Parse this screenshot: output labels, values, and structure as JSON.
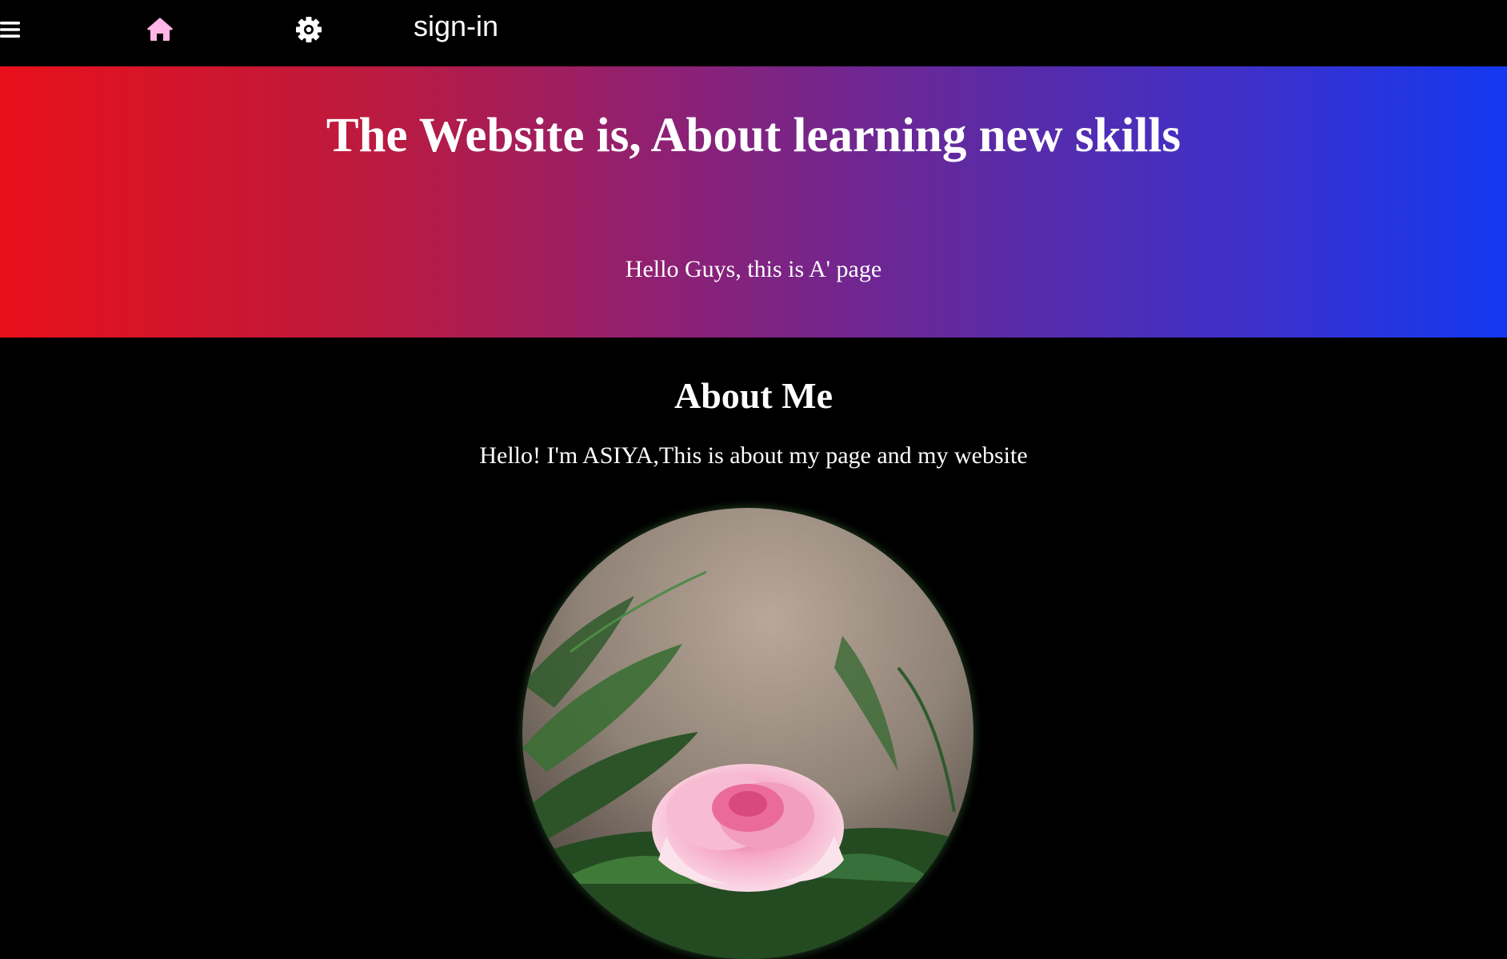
{
  "nav": {
    "menu_icon": "hamburger-menu-icon",
    "home_icon": "home-icon",
    "settings_icon": "gear-icon",
    "signin_label": "sign-in",
    "home_icon_color": "#ffb6e6"
  },
  "hero": {
    "title": "The Website is, About learning new skills",
    "subtitle": "Hello Guys, this is A' page",
    "gradient_start": "#e8101a",
    "gradient_end": "#1338f0"
  },
  "about": {
    "title": "About Me",
    "text": "Hello! I'm ASIYA,This is about my page and my website",
    "image_subject": "pink-rose-photo"
  }
}
